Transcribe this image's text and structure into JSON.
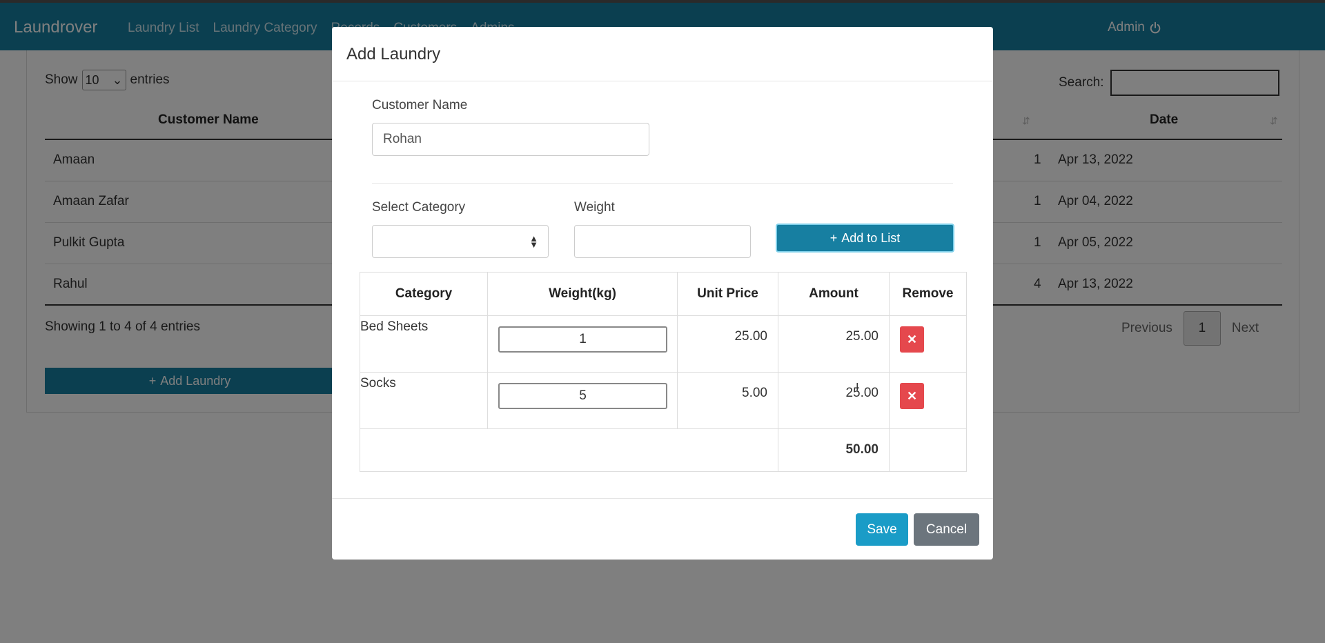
{
  "navbar": {
    "brand": "Laundrover",
    "links": [
      "Laundry List",
      "Laundry Category",
      "Records",
      "Customers",
      "Admins"
    ],
    "admin_label": "Admin"
  },
  "background": {
    "show_label": "Show",
    "entries_value": "10",
    "entries_label": "entries",
    "search_label": "Search:",
    "columns": [
      "Customer Name",
      "Date"
    ],
    "rows": [
      {
        "customer": "Amaan",
        "count": "1",
        "date": "Apr 13, 2022"
      },
      {
        "customer": "Amaan Zafar",
        "count": "1",
        "date": "Apr 04, 2022"
      },
      {
        "customer": "Pulkit Gupta",
        "count": "1",
        "date": "Apr 05, 2022"
      },
      {
        "customer": "Rahul",
        "count": "4",
        "date": "Apr 13, 2022"
      }
    ],
    "showing_text": "Showing 1 to 4 of 4 entries",
    "pager": {
      "previous": "Previous",
      "page": "1",
      "next": "Next"
    },
    "add_laundry_label": "Add Laundry"
  },
  "modal": {
    "title": "Add Laundry",
    "customer_name_label": "Customer Name",
    "customer_name_value": "Rohan",
    "select_category_label": "Select Category",
    "select_category_value": "",
    "weight_label": "Weight",
    "weight_value": "",
    "add_to_list_label": "Add to List",
    "table": {
      "headers": [
        "Category",
        "Weight(kg)",
        "Unit Price",
        "Amount",
        "Remove"
      ],
      "rows": [
        {
          "category": "Bed Sheets",
          "weight": "1",
          "unit_price": "25.00",
          "amount": "25.00"
        },
        {
          "category": "Socks",
          "weight": "5",
          "unit_price": "5.00",
          "amount": "25.00"
        }
      ],
      "total": "50.00"
    },
    "save_label": "Save",
    "cancel_label": "Cancel"
  },
  "icons": {
    "power": "power-icon",
    "plus": "plus-icon",
    "remove": "x-icon",
    "cursor": "text-cursor-icon"
  },
  "colors": {
    "primary": "#177fa1",
    "save": "#1a9cc7",
    "cancel": "#6c757d",
    "danger": "#e5484d"
  }
}
